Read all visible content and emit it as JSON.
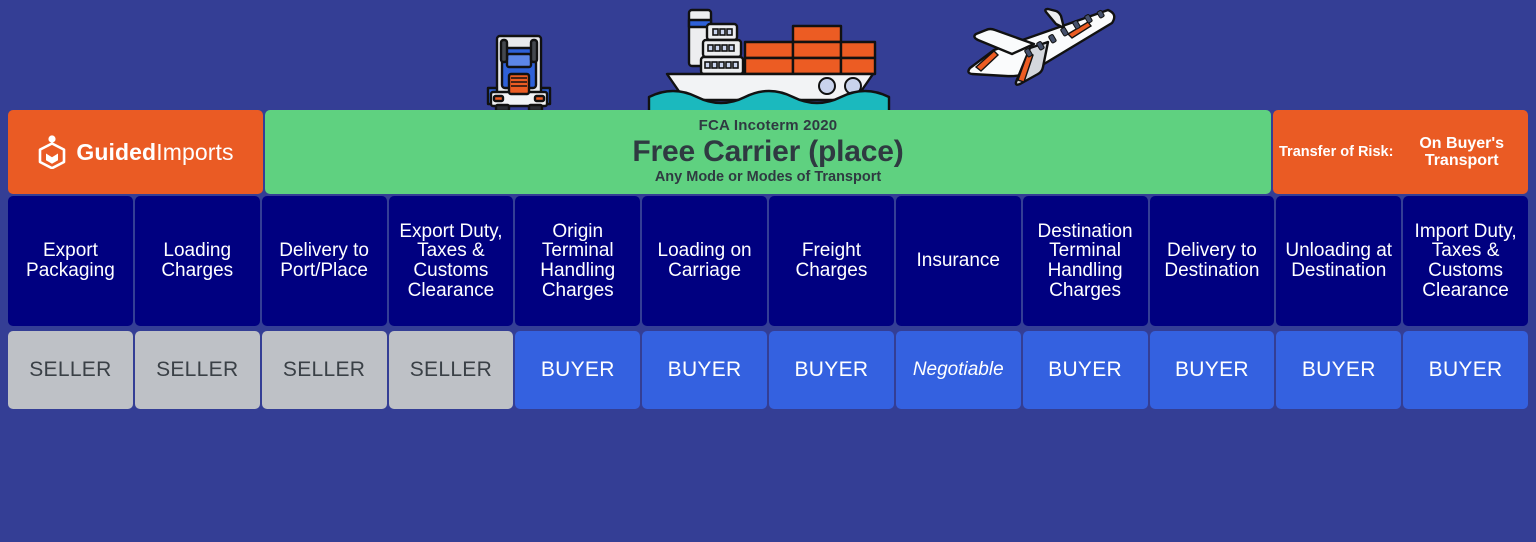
{
  "brand": {
    "logo_icon": "guided-imports-hexagon-logo",
    "name_bold": "Guided",
    "name_light": "Imports"
  },
  "banner": {
    "eyebrow": "FCA Incoterm 2020",
    "title": "Free Carrier (place)",
    "subtitle": "Any Mode or Modes of Transport",
    "bg_color": "#5FD180"
  },
  "risk": {
    "label": "Transfer of Risk:",
    "value": "On Buyer's Transport",
    "bg_color": "#EA5B24"
  },
  "transport_icons": [
    {
      "name": "truck-icon",
      "mode": "Road"
    },
    {
      "name": "container-ship-icon",
      "mode": "Sea"
    },
    {
      "name": "airplane-icon",
      "mode": "Air"
    }
  ],
  "colors": {
    "background": "#343E95",
    "header_cell": "#000080",
    "seller_cell": "#BEC1C6",
    "buyer_cell": "#3461E0",
    "brand_orange": "#EA5B24",
    "banner_green": "#5FD180"
  },
  "table": {
    "columns": [
      {
        "header": "Export Packaging",
        "party": "SELLER"
      },
      {
        "header": "Loading Charges",
        "party": "SELLER"
      },
      {
        "header": "Delivery to Port/Place",
        "party": "SELLER"
      },
      {
        "header": "Export Duty, Taxes & Customs Clearance",
        "party": "SELLER"
      },
      {
        "header": "Origin Terminal Handling Charges",
        "party": "BUYER"
      },
      {
        "header": "Loading on Carriage",
        "party": "BUYER"
      },
      {
        "header": "Freight Charges",
        "party": "BUYER"
      },
      {
        "header": "Insurance",
        "party": "Negotiable"
      },
      {
        "header": "Destination Terminal Handling Charges",
        "party": "BUYER"
      },
      {
        "header": "Delivery to Destination",
        "party": "BUYER"
      },
      {
        "header": "Unloading at Destination",
        "party": "BUYER"
      },
      {
        "header": "Import Duty, Taxes & Customs Clearance",
        "party": "BUYER"
      }
    ]
  }
}
